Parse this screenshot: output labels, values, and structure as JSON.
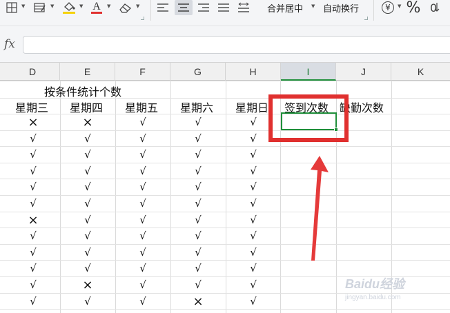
{
  "toolbar": {
    "merge_center_label": "合并居中",
    "wrap_text_label": "自动换行",
    "font_color_letter": "A",
    "percent_symbol": "%",
    "currency_symbol": "¥",
    "accent_color": "#1f8f3a",
    "font_color_underline": "#e0302f",
    "fill_color_underline": "#f5d20a"
  },
  "formula_bar": {
    "fx_label": "fx",
    "value": ""
  },
  "columns": [
    "D",
    "E",
    "F",
    "G",
    "H",
    "I",
    "J",
    "K"
  ],
  "active_column": "I",
  "sheet": {
    "title": "按条件统计个数",
    "headers": [
      "星期三",
      "星期四",
      "星期五",
      "星期六",
      "星期日",
      "签到次数",
      "缺勤次数"
    ],
    "rows": [
      [
        "×",
        "×",
        "√",
        "√",
        "√"
      ],
      [
        "√",
        "√",
        "√",
        "√",
        "√"
      ],
      [
        "√",
        "√",
        "√",
        "√",
        "√"
      ],
      [
        "√",
        "√",
        "√",
        "√",
        "√"
      ],
      [
        "√",
        "√",
        "√",
        "√",
        "√"
      ],
      [
        "√",
        "√",
        "√",
        "√",
        "√"
      ],
      [
        "×",
        "√",
        "√",
        "√",
        "√"
      ],
      [
        "√",
        "√",
        "√",
        "√",
        "√"
      ],
      [
        "√",
        "√",
        "√",
        "√",
        "√"
      ],
      [
        "√",
        "√",
        "√",
        "√",
        "√"
      ],
      [
        "√",
        "×",
        "√",
        "√",
        "√"
      ],
      [
        "√",
        "√",
        "√",
        "×",
        "√"
      ]
    ]
  },
  "annotation": {
    "box_color": "#e0302f",
    "arrow_color": "#e53a3a"
  },
  "watermark": {
    "text": "Baidu经验",
    "sub": "jingyan.baidu.com"
  }
}
